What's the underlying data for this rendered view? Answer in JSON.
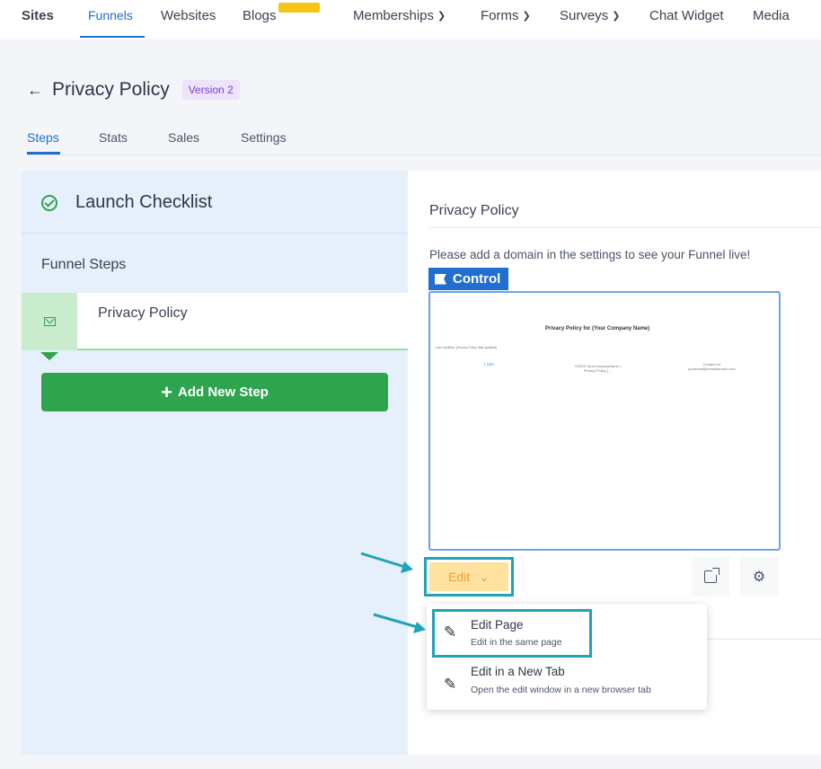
{
  "topnav": {
    "items": [
      "Sites",
      "Funnels",
      "Websites",
      "Blogs",
      "Memberships",
      "Forms",
      "Surveys",
      "Chat Widget",
      "Media"
    ],
    "active": "Funnels"
  },
  "header": {
    "title": "Privacy Policy",
    "version_badge": "Version 2",
    "tabs": [
      "Steps",
      "Stats",
      "Sales",
      "Settings"
    ]
  },
  "left": {
    "checklist_title": "Launch Checklist",
    "steps_label": "Funnel Steps",
    "step_name": "Privacy Policy",
    "add_step_label": "Add New Step"
  },
  "right": {
    "title": "Privacy Policy",
    "hint": "Please add a domain in the settings to see your Funnel live!",
    "control_label": "Control",
    "preview": {
      "title": "Privacy Policy for (Your Company Name)",
      "line": "Last modified: (Privacy Policy date updated)",
      "logo": "Logo",
      "col2_line1": "©2023 YourCompanyName |",
      "col2_line2": "Privacy Policy | ...",
      "col3_line1": "Contact Us",
      "col3_line2": "youremail@emaildomain.com"
    },
    "edit_label": "Edit"
  },
  "dropdown": {
    "items": [
      {
        "title": "Edit Page",
        "subtitle": "Edit in the same page"
      },
      {
        "title": "Edit in a New Tab",
        "subtitle": "Open the edit window in a new browser tab"
      }
    ]
  },
  "colors": {
    "primary_blue": "#1f6fd1",
    "green": "#2ea44f",
    "highlight_teal": "#1fa3b8",
    "edit_bg": "#ffe2a0"
  }
}
